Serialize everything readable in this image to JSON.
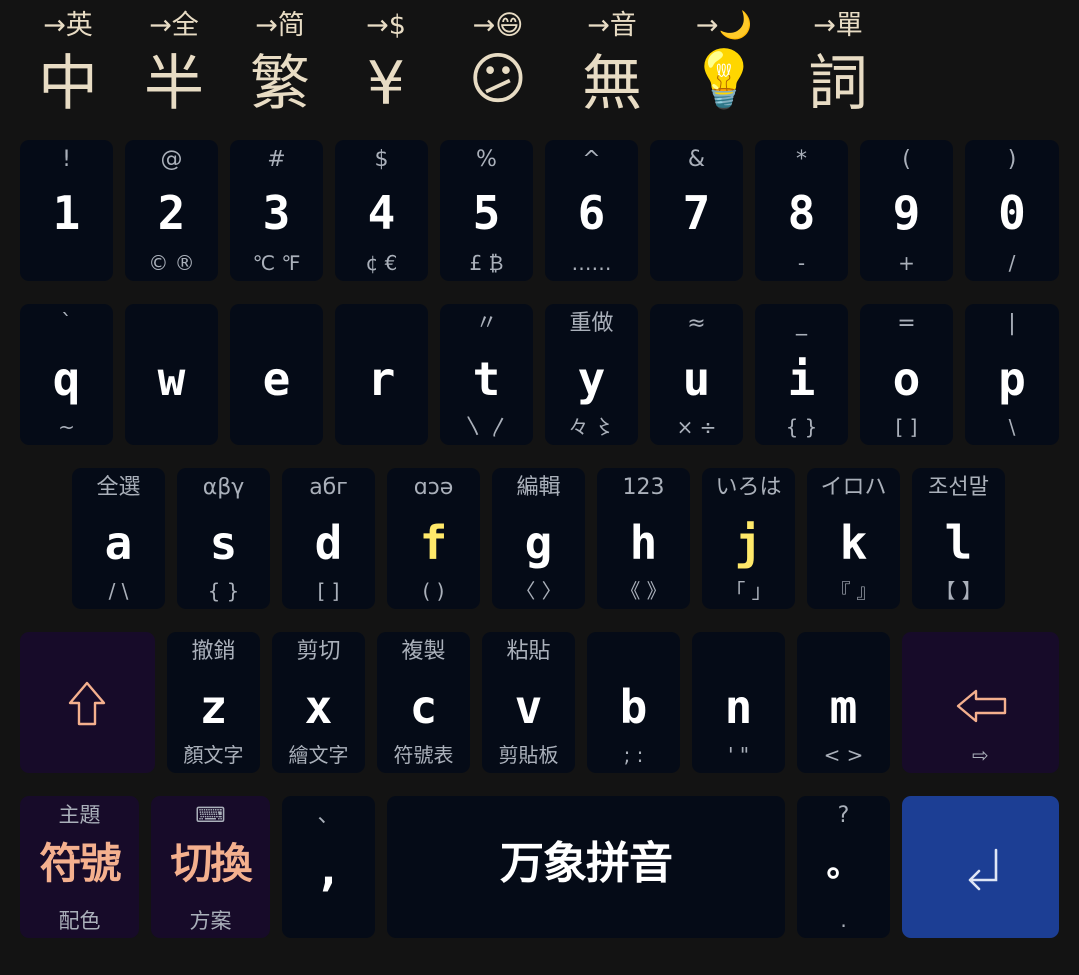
{
  "switcher": [
    {
      "name": "switch-ascii",
      "hint": "→英",
      "label": "中"
    },
    {
      "name": "switch-fullwidth",
      "hint": "→全",
      "label": "半"
    },
    {
      "name": "switch-simplified",
      "hint": "→简",
      "label": "繁"
    },
    {
      "name": "switch-currency",
      "hint": "→$",
      "label": "¥"
    },
    {
      "name": "switch-emoji",
      "hint": "→😄",
      "label": "😕"
    },
    {
      "name": "switch-sound",
      "hint": "→音",
      "label": "無"
    },
    {
      "name": "switch-darkmode",
      "hint": "→🌙",
      "label": "💡"
    },
    {
      "name": "switch-words",
      "hint": "→單",
      "label": "詞"
    }
  ],
  "rows": {
    "numbers": [
      {
        "top": "!",
        "main": "1",
        "bottom": ""
      },
      {
        "top": "@",
        "main": "2",
        "bottom": "©  ®"
      },
      {
        "top": "#",
        "main": "3",
        "bottom": "℃  ℉"
      },
      {
        "top": "$",
        "main": "4",
        "bottom": "¢  €"
      },
      {
        "top": "%",
        "main": "5",
        "bottom": "£  ₿"
      },
      {
        "top": "^",
        "main": "6",
        "bottom": "……"
      },
      {
        "top": "&",
        "main": "7",
        "bottom": ""
      },
      {
        "top": "*",
        "main": "8",
        "bottom": "-"
      },
      {
        "top": "(",
        "main": "9",
        "bottom": "+"
      },
      {
        "top": ")",
        "main": "0",
        "bottom": "/"
      }
    ],
    "q": [
      {
        "top": "`",
        "main": "q",
        "bottom": "~"
      },
      {
        "top": "",
        "main": "w",
        "bottom": ""
      },
      {
        "top": "",
        "main": "e",
        "bottom": ""
      },
      {
        "top": "",
        "main": "r",
        "bottom": ""
      },
      {
        "top": "〃",
        "main": "t",
        "bottom": "〵  〳"
      },
      {
        "top": "重做",
        "main": "y",
        "bottom": "々  〻"
      },
      {
        "top": "≈",
        "main": "u",
        "bottom": "×  ÷"
      },
      {
        "top": "_",
        "main": "i",
        "bottom": "{  }"
      },
      {
        "top": "=",
        "main": "o",
        "bottom": "[  ]"
      },
      {
        "top": "|",
        "main": "p",
        "bottom": "\\"
      }
    ],
    "a": [
      {
        "top": "全選",
        "main": "a",
        "bottom": "/  \\"
      },
      {
        "top": "αβγ",
        "main": "s",
        "bottom": "{  }"
      },
      {
        "top": "абг",
        "main": "d",
        "bottom": "[  ]"
      },
      {
        "top": "ɑɔə",
        "main": "f",
        "bottom": "(  )"
      },
      {
        "top": "編輯",
        "main": "g",
        "bottom": "〈 〉"
      },
      {
        "top": "123",
        "main": "h",
        "bottom": "《 》"
      },
      {
        "top": "いろは",
        "main": "j",
        "bottom": "「 」"
      },
      {
        "top": "イロハ",
        "main": "k",
        "bottom": "『 』"
      },
      {
        "top": "조선말",
        "main": "l",
        "bottom": "【 】"
      }
    ],
    "z": [
      {
        "top": "撤銷",
        "main": "z",
        "bottom": "顏文字"
      },
      {
        "top": "剪切",
        "main": "x",
        "bottom": "繪文字"
      },
      {
        "top": "複製",
        "main": "c",
        "bottom": "符號表"
      },
      {
        "top": "粘貼",
        "main": "v",
        "bottom": "剪貼板"
      },
      {
        "top": "",
        "main": "b",
        "bottom": ";  :"
      },
      {
        "top": "",
        "main": "n",
        "bottom": "'  \""
      },
      {
        "top": "",
        "main": "m",
        "bottom": "<  >"
      }
    ]
  },
  "bottom": {
    "symbols": {
      "top": "主題",
      "main": "符號",
      "bottom": "配色"
    },
    "schema": {
      "top": "⌨",
      "main": "切換",
      "bottom": "方案"
    },
    "comma": {
      "top": "、",
      "main": ","
    },
    "space": {
      "label": "万象拼音"
    },
    "period": {
      "top": "?",
      "main": "。",
      "bottom": "."
    },
    "backspace_swipe": "⇨"
  },
  "colors": {
    "key_bg": "#050b17",
    "func_bg": "#170b29",
    "enter_bg": "#1c3e94",
    "accent_yellow": "#ffe96a",
    "accent_orange": "#f4b08e",
    "switcher_text": "#e8dcc4"
  }
}
